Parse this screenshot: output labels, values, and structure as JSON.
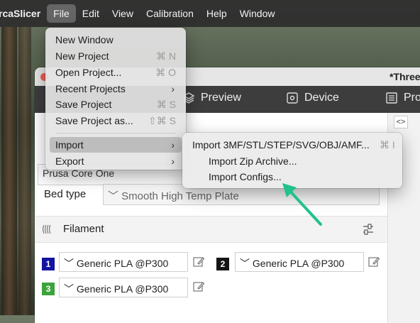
{
  "menubar": {
    "app": "rcaSlicer",
    "items": [
      "File",
      "Edit",
      "View",
      "Calibration",
      "Help",
      "Window"
    ]
  },
  "window": {
    "title": "*Three",
    "tabs": {
      "preview": "Preview",
      "device": "Device",
      "project": "Pro"
    },
    "printer_value": "Prusa Core One",
    "bed_type_label": "Bed type",
    "bed_type_value": "Smooth High Temp Plate",
    "filament_label": "Filament",
    "filaments": [
      {
        "slot": "1",
        "color": "#1414a0",
        "name": "Generic PLA @P300"
      },
      {
        "slot": "2",
        "color": "#151515",
        "name": "Generic PLA @P300"
      },
      {
        "slot": "3",
        "color": "#3da33d",
        "name": "Generic PLA @P300"
      }
    ]
  },
  "file_menu": {
    "items": [
      {
        "label": "New Window",
        "shortcut": ""
      },
      {
        "label": "New Project",
        "shortcut": "⌘ N"
      },
      {
        "label": "Open Project...",
        "shortcut": "⌘ O"
      },
      {
        "label": "Recent Projects",
        "shortcut": ""
      },
      {
        "label": "Save Project",
        "shortcut": "⌘ S"
      },
      {
        "label": "Save Project as...",
        "shortcut": "⇧⌘ S"
      },
      {
        "label": "Import",
        "shortcut": ""
      },
      {
        "label": "Export",
        "shortcut": ""
      }
    ],
    "highlighted": "Import"
  },
  "import_submenu": {
    "items": [
      {
        "label": "Import 3MF/STL/STEP/SVG/OBJ/AMF...",
        "shortcut": "⌘ I"
      },
      {
        "label": "Import Zip Archive..."
      },
      {
        "label": "Import Configs..."
      }
    ]
  },
  "annotation": {
    "arrow_color": "#22c28a"
  }
}
